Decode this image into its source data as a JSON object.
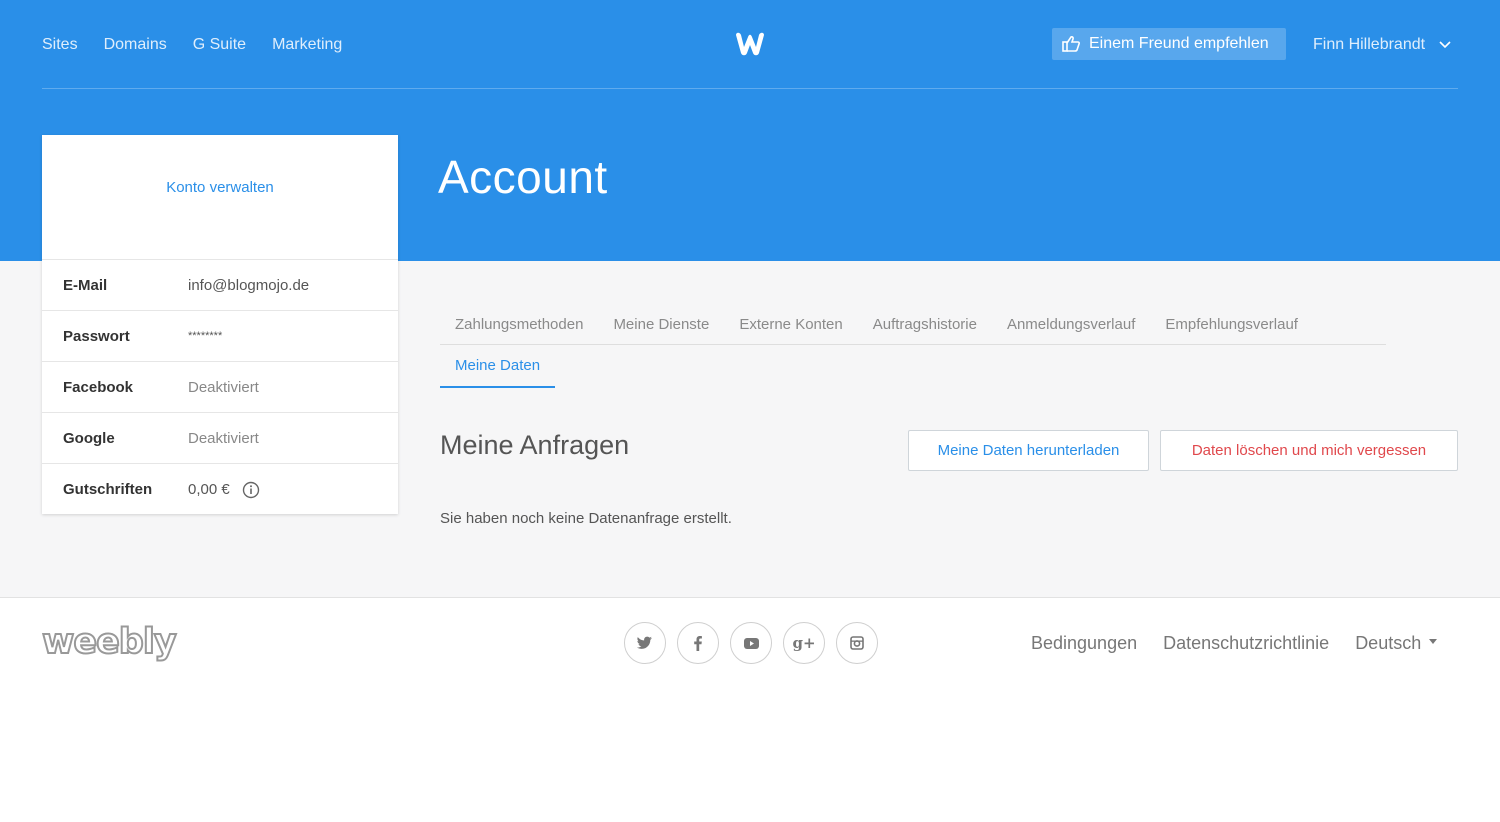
{
  "nav": {
    "items": [
      "Sites",
      "Domains",
      "G Suite",
      "Marketing"
    ],
    "refer_label": "Einem Freund empfehlen",
    "user_name": "Finn Hillebrandt"
  },
  "page": {
    "title": "Account"
  },
  "card": {
    "manage_link": "Konto verwalten",
    "rows": [
      {
        "key": "E-Mail",
        "value": "info@blogmojo.de"
      },
      {
        "key": "Passwort",
        "value": "********"
      },
      {
        "key": "Facebook",
        "value": "Deaktiviert"
      },
      {
        "key": "Google",
        "value": "Deaktiviert"
      },
      {
        "key": "Gutschriften",
        "value": "0,00 €"
      }
    ]
  },
  "tabs": {
    "row1": [
      "Zahlungsmethoden",
      "Meine Dienste",
      "Externe Konten",
      "Auftragshistorie",
      "Anmeldungsverlauf",
      "Empfehlungsverlauf"
    ],
    "active": "Meine Daten"
  },
  "requests": {
    "title": "Meine Anfragen",
    "download_label": "Meine Daten herunterladen",
    "delete_label": "Daten löschen und mich vergessen",
    "empty_message": "Sie haben noch keine Datenanfrage erstellt."
  },
  "footer": {
    "logo": "weebly",
    "social_icons": [
      "twitter-icon",
      "facebook-icon",
      "youtube-icon",
      "google-plus-icon",
      "instagram-icon"
    ],
    "links": [
      "Bedingungen",
      "Datenschutzrichtlinie"
    ],
    "language": "Deutsch"
  },
  "colors": {
    "brand_blue": "#2a8fe8",
    "danger": "#e0484c",
    "band_grey": "#f6f6f7"
  }
}
